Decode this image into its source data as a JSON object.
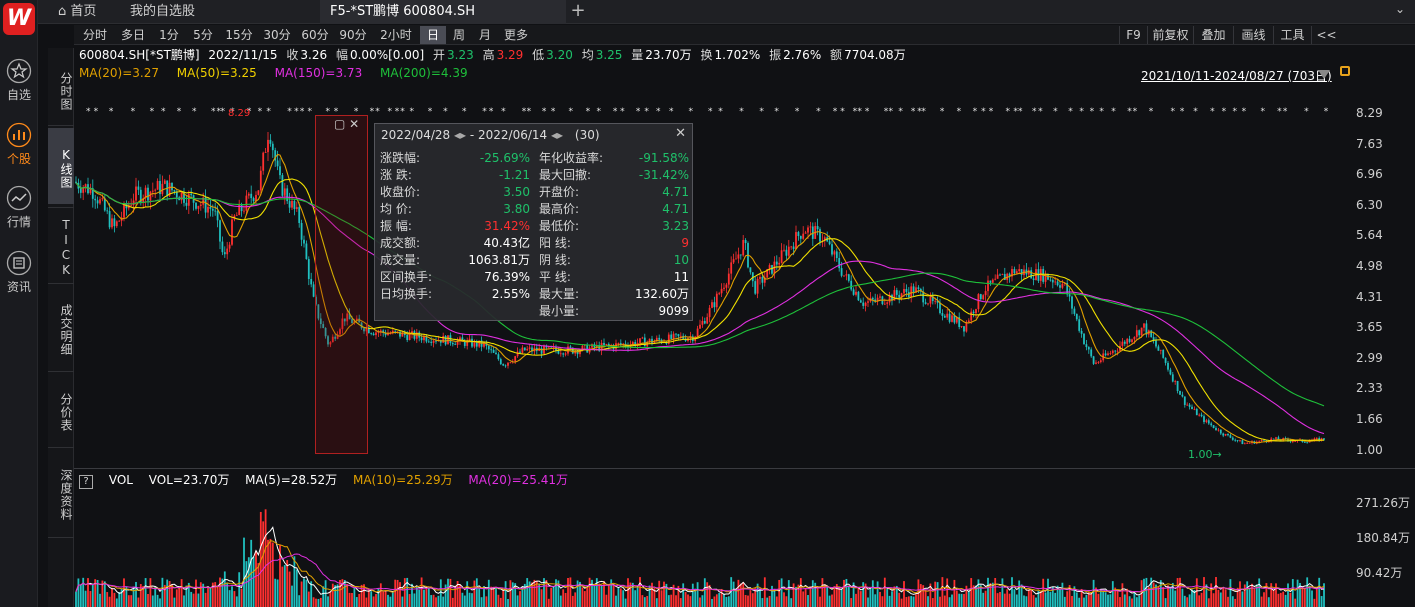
{
  "app": {
    "logo": "W"
  },
  "nav": [
    {
      "label": "自选",
      "icon": "star-icon"
    },
    {
      "label": "个股",
      "icon": "chart-icon"
    },
    {
      "label": "行情",
      "icon": "wave-icon"
    },
    {
      "label": "资讯",
      "icon": "news-icon"
    }
  ],
  "tabs": {
    "home": "首页",
    "watchlist": "我的自选股",
    "current": "F5-*ST鹏博 600804.SH"
  },
  "periods": [
    "分时",
    "多日",
    "1分",
    "5分",
    "15分",
    "30分",
    "60分",
    "90分",
    "2小时",
    "日",
    "周",
    "月",
    "更多"
  ],
  "selected_period": "日",
  "right_tools": [
    "F9",
    "前复权",
    "叠加",
    "画线",
    "工具",
    "<<"
  ],
  "side_tabs": [
    "分时图",
    "K线图",
    "TICK",
    "成交明细",
    "分价表",
    "深度资料"
  ],
  "quote": {
    "code": "600804.SH[*ST鹏博]",
    "date": "2022/11/15",
    "close_label": "收",
    "close": "3.26",
    "chg_label": "幅",
    "chg": "0.00%[0.00]",
    "open_label": "开",
    "open": "3.23",
    "high_label": "高",
    "high": "3.29",
    "low_label": "低",
    "low": "3.20",
    "avg_label": "均",
    "avg": "3.25",
    "vol_label": "量",
    "vol": "23.70万",
    "turn_label": "换",
    "turn": "1.702%",
    "amp_label": "振",
    "amp": "2.76%",
    "amt_label": "额",
    "amt": "7704.08万"
  },
  "ma": {
    "ma20": "MA(20)=3.27",
    "ma50": "MA(50)=3.25",
    "ma150": "MA(150)=3.73",
    "ma200": "MA(200)=4.39"
  },
  "range": "2021/10/11-2024/08/27 (703日)",
  "y_labels": [
    "8.29",
    "7.63",
    "6.96",
    "6.30",
    "5.64",
    "4.98",
    "4.31",
    "3.65",
    "2.99",
    "2.33",
    "1.66",
    "1.00"
  ],
  "annotations": {
    "high": "8.29",
    "low": "1.00"
  },
  "vol": {
    "title": "VOL",
    "vol": "VOL=23.70万",
    "ma5": "MA(5)=28.52万",
    "ma10": "MA(10)=25.29万",
    "ma20": "MA(20)=25.41万",
    "y_labels": [
      "271.26万",
      "180.84万",
      "90.42万"
    ],
    "help": "?"
  },
  "tooltip": {
    "start": "2022/04/28",
    "end": "- 2022/06/14",
    "count": "(30)",
    "left": [
      {
        "k": "涨跌幅:",
        "v": "-25.69%",
        "c": "green"
      },
      {
        "k": "涨  跌:",
        "v": "-1.21",
        "c": "green"
      },
      {
        "k": "收盘价:",
        "v": "3.50",
        "c": "green"
      },
      {
        "k": "均  价:",
        "v": "3.80",
        "c": "green"
      },
      {
        "k": "振  幅:",
        "v": "31.42%",
        "c": "red"
      },
      {
        "k": "成交额:",
        "v": "40.43亿",
        "c": "white"
      },
      {
        "k": "成交量:",
        "v": "1063.81万",
        "c": "white"
      },
      {
        "k": "区间换手:",
        "v": "76.39%",
        "c": "white"
      },
      {
        "k": "日均换手:",
        "v": "2.55%",
        "c": "white"
      }
    ],
    "right": [
      {
        "k": "年化收益率:",
        "v": "-91.58%",
        "c": "green"
      },
      {
        "k": "最大回撤:",
        "v": "-31.42%",
        "c": "green"
      },
      {
        "k": "开盘价:",
        "v": "4.71",
        "c": "green"
      },
      {
        "k": "最高价:",
        "v": "4.71",
        "c": "green"
      },
      {
        "k": "最低价:",
        "v": "3.23",
        "c": "green"
      },
      {
        "k": "阳  线:",
        "v": "9",
        "c": "red"
      },
      {
        "k": "阴  线:",
        "v": "10",
        "c": "green"
      },
      {
        "k": "平  线:",
        "v": "11",
        "c": "white"
      },
      {
        "k": "最大量:",
        "v": "132.60万",
        "c": "white"
      },
      {
        "k": "最小量:",
        "v": "9099",
        "c": "white"
      }
    ]
  },
  "colors": {
    "up": "#ff3030",
    "down": "#20c0c0",
    "ma20": "#e0a000",
    "ma50": "#f0e000",
    "ma150": "#e030e0",
    "ma200": "#1ec03a",
    "bg": "#101114"
  }
}
